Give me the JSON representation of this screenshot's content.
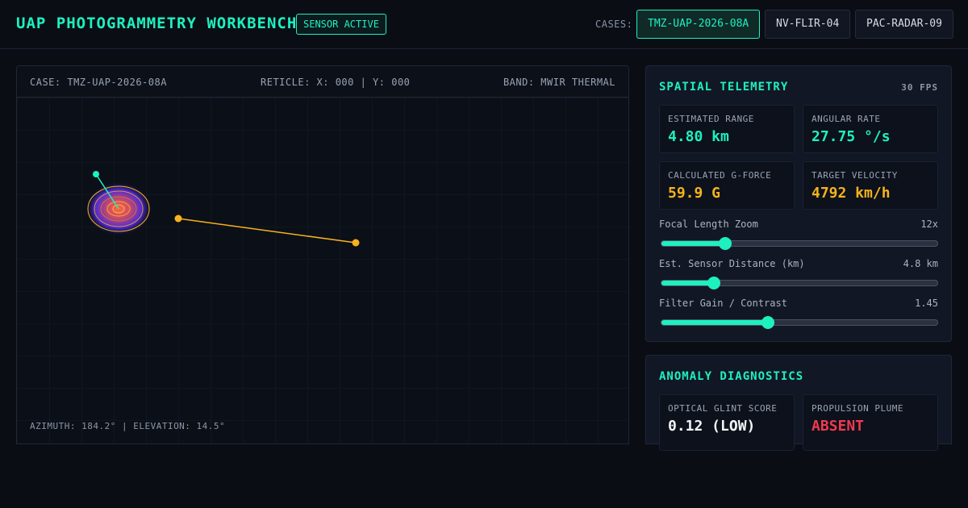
{
  "header": {
    "title": "UAP PHOTOGRAMMETRY WORKBENCH",
    "status": "SENSOR ACTIVE",
    "cases_label": "CASES:",
    "cases": [
      {
        "label": "TMZ-UAP-2026-08A",
        "active": true
      },
      {
        "label": "NV-FLIR-04",
        "active": false
      },
      {
        "label": "PAC-RADAR-09",
        "active": false
      }
    ]
  },
  "viewer": {
    "case": "CASE: TMZ-UAP-2026-08A",
    "reticle": "RETICLE: X: 000 | Y: 000",
    "band": "BAND: MWIR THERMAL",
    "footer": "AZIMUTH: 184.2° | ELEVATION: 14.5°"
  },
  "telemetry": {
    "title": "SPATIAL TELEMETRY",
    "fps": "30 FPS",
    "cards": [
      {
        "label": "ESTIMATED RANGE",
        "value": "4.80 km",
        "color": "#1ef0c0"
      },
      {
        "label": "ANGULAR RATE",
        "value": "27.75 °/s",
        "color": "#1ef0c0"
      },
      {
        "label": "CALCULATED G-FORCE",
        "value": "59.9 G",
        "color": "#f7b21c"
      },
      {
        "label": "TARGET VELOCITY",
        "value": "4792 km/h",
        "color": "#f7b21c"
      }
    ],
    "sliders": [
      {
        "label": "Focal Length Zoom",
        "value": "12x",
        "level": 0.23
      },
      {
        "label": "Est. Sensor Distance (km)",
        "value": "4.8 km",
        "level": 0.19
      },
      {
        "label": "Filter Gain / Contrast",
        "value": "1.45",
        "level": 0.385
      }
    ]
  },
  "diagnostics": {
    "title": "ANOMALY DIAGNOSTICS",
    "cards": [
      {
        "label": "OPTICAL GLINT SCORE",
        "value": "0.12 (LOW)",
        "color": "#f1f4f8"
      },
      {
        "label": "PROPULSION PLUME",
        "value": "ABSENT",
        "color": "#f0394f"
      }
    ]
  },
  "colors": {
    "accent": "#1ef0c0",
    "warning": "#f7b21c",
    "alert": "#f0394f"
  }
}
